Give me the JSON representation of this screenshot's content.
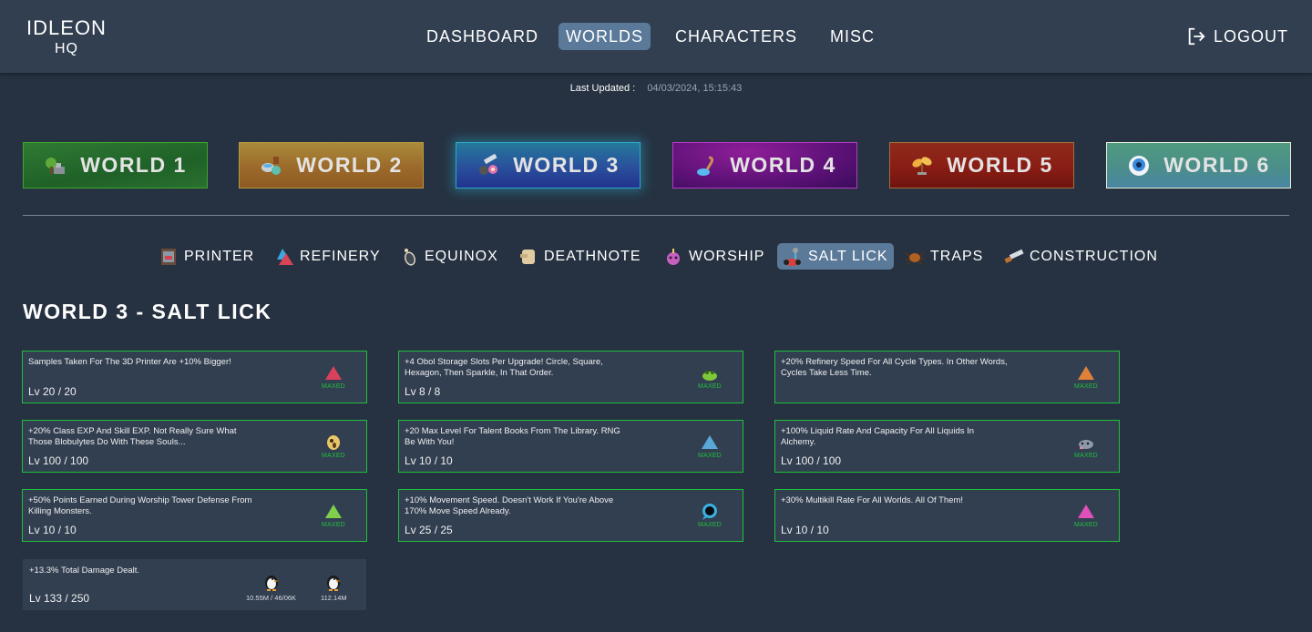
{
  "header": {
    "logo_line1": "IDLEON",
    "logo_line2": "HQ",
    "nav": [
      {
        "label": "DASHBOARD",
        "active": false
      },
      {
        "label": "WORLDS",
        "active": true
      },
      {
        "label": "CHARACTERS",
        "active": false
      },
      {
        "label": "MISC",
        "active": false
      }
    ],
    "logout_label": "LOGOUT"
  },
  "last_updated": {
    "label": "Last Updated :",
    "value": "04/03/2024, 15:15:43"
  },
  "worlds": [
    {
      "label": "WORLD 1",
      "icon": "anvil-tree-icon",
      "active": false
    },
    {
      "label": "WORLD 2",
      "icon": "alchemy-cauldron-icon",
      "active": false
    },
    {
      "label": "WORLD 3",
      "icon": "construction-saw-icon",
      "active": true
    },
    {
      "label": "WORLD 4",
      "icon": "cooking-ladle-icon",
      "active": false
    },
    {
      "label": "WORLD 5",
      "icon": "gaming-sprout-icon",
      "active": false
    },
    {
      "label": "WORLD 6",
      "icon": "farming-eye-icon",
      "active": false
    }
  ],
  "subnav": [
    {
      "label": "PRINTER",
      "icon": "printer-icon",
      "active": false
    },
    {
      "label": "REFINERY",
      "icon": "refinery-salt-icon",
      "active": false
    },
    {
      "label": "EQUINOX",
      "icon": "equinox-icon",
      "active": false
    },
    {
      "label": "DEATHNOTE",
      "icon": "deathnote-scroll-icon",
      "active": false
    },
    {
      "label": "WORSHIP",
      "icon": "worship-skull-icon",
      "active": false
    },
    {
      "label": "SALT LICK",
      "icon": "salt-lick-icon",
      "active": true
    },
    {
      "label": "TRAPS",
      "icon": "trap-spider-icon",
      "active": false
    },
    {
      "label": "CONSTRUCTION",
      "icon": "saw-icon",
      "active": false
    }
  ],
  "page_title": "WORLD 3 - SALT LICK",
  "maxed_label": "MAXED",
  "bonuses": [
    {
      "desc": "Samples Taken For The 3D Printer Are +10% Bigger!",
      "level": "Lv 20 / 20",
      "maxed": true,
      "item": "red-salt-icon",
      "color": "#d9425a"
    },
    {
      "desc": "+4 Obol Storage Slots Per Upgrade! Circle, Square, Hexagon, Then Sparkle, In That Order.",
      "level": "Lv 8 / 8",
      "maxed": true,
      "item": "green-frog-icon",
      "color": "#7ec83a"
    },
    {
      "desc": "+20% Refinery Speed For All Cycle Types. In Other Words, Cycles Take Less Time.",
      "level": "",
      "maxed": true,
      "item": "orange-salt-icon",
      "color": "#e0813a"
    },
    {
      "desc": "+20% Class EXP And Skill EXP. Not Really Sure What Those Blobulytes Do With These Souls...",
      "level": "Lv 100 / 100",
      "maxed": true,
      "item": "soul-ghost-icon",
      "color": "#e8c768"
    },
    {
      "desc": "+20 Max Level For Talent Books From The Library. RNG Be With You!",
      "level": "Lv 10 / 10",
      "maxed": true,
      "item": "blue-salt-icon",
      "color": "#5aa8d8"
    },
    {
      "desc": "+100% Liquid Rate And Capacity For All Liquids In Alchemy.",
      "level": "Lv 100 / 100",
      "maxed": true,
      "item": "gray-rat-icon",
      "color": "#8d98a8"
    },
    {
      "desc": "+50% Points Earned During Worship Tower Defense From Killing Monsters.",
      "level": "Lv 10 / 10",
      "maxed": true,
      "item": "green-salt-icon",
      "color": "#7ed04a"
    },
    {
      "desc": "+10% Movement Speed. Doesn't Work If You're Above 170% Move Speed Already.",
      "level": "Lv 25 / 25",
      "maxed": true,
      "item": "blue-orb-icon",
      "color": "#3ab0e0"
    },
    {
      "desc": "+30% Multikill Rate For All Worlds. All Of Them!",
      "level": "Lv 10 / 10",
      "maxed": true,
      "item": "pink-salt-icon",
      "color": "#e050b8"
    },
    {
      "desc": "+13.3% Total Damage Dealt.",
      "level": "Lv 133 / 250",
      "maxed": false,
      "costs": [
        {
          "item": "penguin-icon",
          "text": "10.55M / 46/06K"
        },
        {
          "item": "penguin-icon",
          "text": "112.14M"
        }
      ]
    }
  ]
}
